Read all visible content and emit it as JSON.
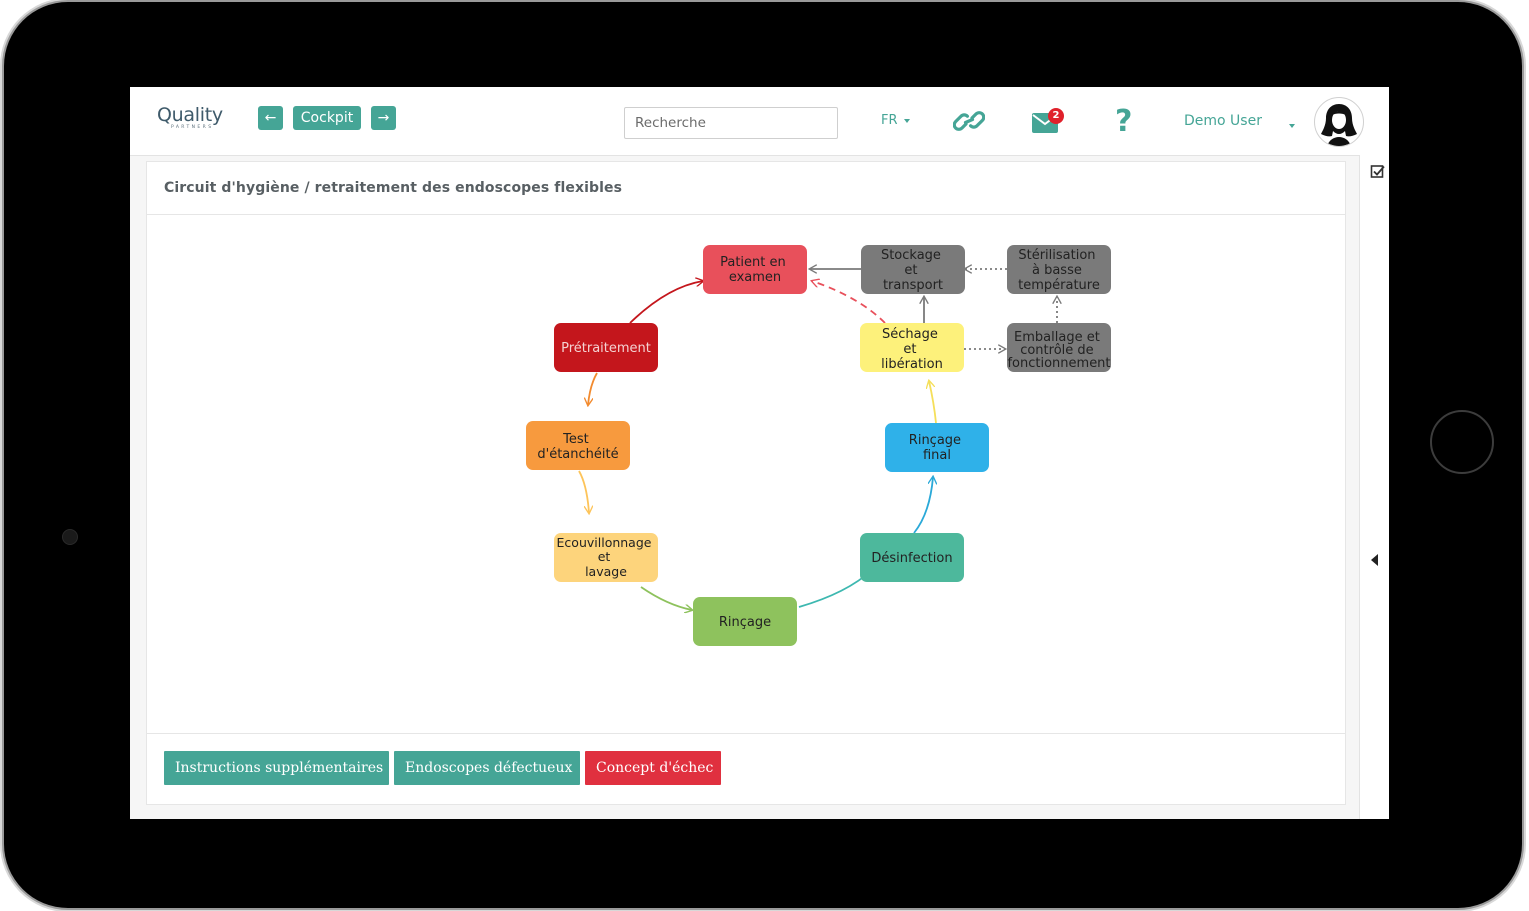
{
  "header": {
    "logo_main": "Quality",
    "logo_sub": "PARTNERS",
    "back_icon": "arrow-left-icon",
    "forward_icon": "arrow-right-icon",
    "cockpit_label": "Cockpit",
    "search_placeholder": "Recherche",
    "language": "FR",
    "link_icon": "link-icon",
    "mail_icon": "envelope-icon",
    "mail_badge": "2",
    "help_label": "?",
    "user_name": "Demo User"
  },
  "panel": {
    "title": "Circuit d'hygiène / retraitement des endoscopes flexibles"
  },
  "diagram": {
    "nodes": {
      "patient": [
        "Patient en",
        "examen"
      ],
      "stockage": [
        "Stockage",
        "et",
        "transport"
      ],
      "sterilisation": [
        "Stérilisation",
        "à basse",
        "température"
      ],
      "pretraitement": [
        "Prétraitement"
      ],
      "sechage": [
        "Séchage",
        "et",
        "libération"
      ],
      "emballage": [
        "Emballage et",
        "contrôle de",
        "fonctionnement"
      ],
      "test": [
        "Test",
        "d'étanchéité"
      ],
      "rincage_final": [
        "Rinçage",
        "final"
      ],
      "ecouvillonnage": [
        "Ecouvillonnage",
        "et",
        "lavage"
      ],
      "desinfection": [
        "Désinfection"
      ],
      "rincage": [
        "Rinçage"
      ]
    },
    "colors": {
      "red": "#e8505b",
      "darkred": "#c4161c",
      "orange": "#f79a3e",
      "lightorange": "#fdd47c",
      "green": "#8ec25d",
      "teal": "#4db89c",
      "blue": "#2fb1e9",
      "yellow": "#fdf17b",
      "gray": "#7a7a7a"
    }
  },
  "footer": {
    "btn_instructions": "Instructions supplémentaires",
    "btn_endoscopes": "Endoscopes défectueux",
    "btn_concept": "Concept d'échec",
    "accent": "#45a596",
    "danger": "#e0303f"
  },
  "sidebar": {
    "checklist_icon": "checklist-icon",
    "collapse_icon": "caret-left-icon"
  }
}
